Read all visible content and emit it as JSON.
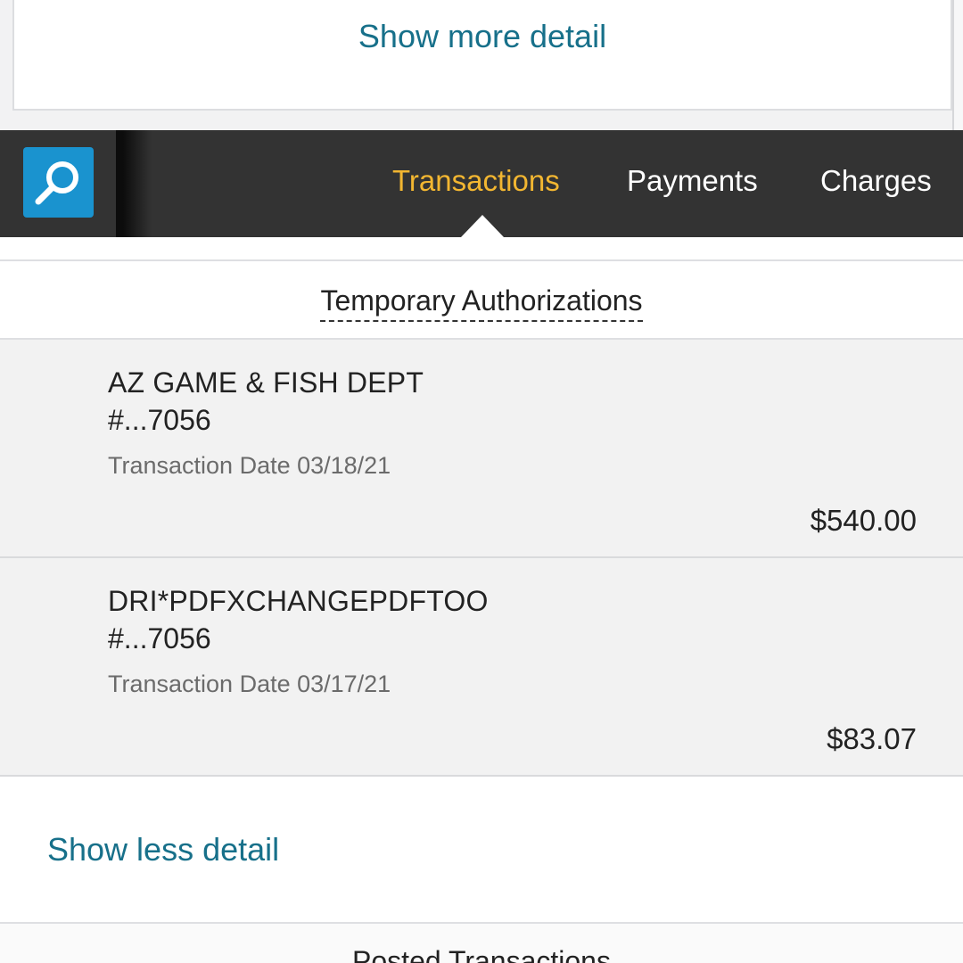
{
  "top_card": {
    "link_label": "Show more detail"
  },
  "nav": {
    "tabs": [
      {
        "label": "Transactions",
        "active": true
      },
      {
        "label": "Payments",
        "active": false
      },
      {
        "label": "Charges",
        "active": false
      }
    ],
    "search_icon": "search-icon",
    "colors": {
      "bar": "#333333",
      "active_tab": "#f2b631",
      "search_button": "#1a93cf"
    }
  },
  "section": {
    "title": "Temporary Authorizations"
  },
  "transactions": [
    {
      "merchant": "AZ GAME & FISH DEPT",
      "account": "#...7056",
      "date": "Transaction Date 03/18/21",
      "amount": "$540.00"
    },
    {
      "merchant": "DRI*PDFXCHANGEPDFTOO",
      "account": "#...7056",
      "date": "Transaction Date 03/17/21",
      "amount": "$83.07"
    }
  ],
  "less_detail_label": "Show less detail",
  "posted": {
    "title": "Posted Transactions"
  }
}
